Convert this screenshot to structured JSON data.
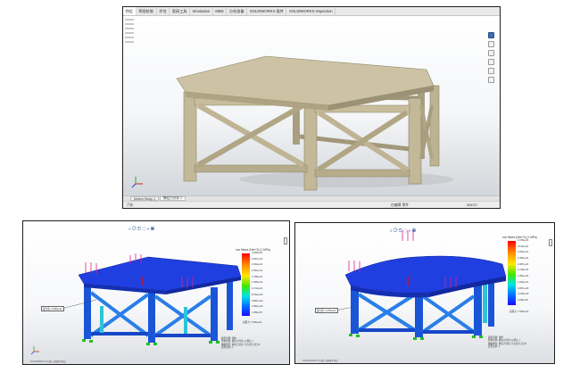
{
  "top_window": {
    "tabs": [
      "特征",
      "草图绘制",
      "评估",
      "直接工具",
      "Simulation",
      "MBD",
      "分析准备",
      "SOLIDWORKS 插件",
      "SOLIDWORKS Inspection"
    ],
    "active_tab_index": 0,
    "study_tabs": [
      "Motion Study 1",
      "静应力分析 1"
    ],
    "active_study_index": 1,
    "status": {
      "left": "汽车",
      "middle": "在编辑 零件",
      "right": "MMGS"
    }
  },
  "bottom_left": {
    "plot_title": "von Mises (N/m^2) (1 MPa)",
    "legend_ticks": [
      "2.930e+01",
      "2.637e+01",
      "2.344e+01",
      "2.051e+01",
      "1.758e+01",
      "1.465e+01",
      "1.172e+01",
      "8.792e+00",
      "5.861e+00",
      "2.931e+00",
      "1.456e-05"
    ],
    "probe_label": "最大值: 2.930e+01",
    "yield_label": "屈服力: 7.500e+01",
    "info_lines": [
      "模型名称: 钢台",
      "算例名称: 静应力分析 1(-默认-)",
      "图解类型: 静应力分析 节点应力 应力1",
      "变形比例: 1"
    ],
    "footer": "SOLIDWORKS 学习版: 仅限教学用途"
  },
  "bottom_right": {
    "plot_title": "von Mises (N/m^2) (1 MPa)",
    "legend_ticks": [
      "3.478e+01",
      "3.130e+01",
      "2.782e+01",
      "2.435e+01",
      "2.087e+01",
      "1.739e+01",
      "1.391e+01",
      "1.043e+01",
      "6.957e+00",
      "3.478e+00",
      "3.026e-05"
    ],
    "probe_label": "最大值: 3.478e+01",
    "yield_label": "屈服力: 7.500e+01",
    "info_lines": [
      "模型名称: 钢台",
      "算例名称: 静应力分析 2(-默认-)",
      "图解类型: 静应力分析 节点应力 应力1",
      "变形比例: 1"
    ],
    "footer": "SOLIDWORKS 学习版: 仅限教学用途"
  },
  "colors": {
    "model_tan": "#c8bd9c",
    "fea_blue": "#1f3fe0"
  },
  "icons": [
    "zoom-icon",
    "rotate-icon",
    "view-orientation-icon",
    "display-style-icon",
    "coordinate-triad-icon"
  ]
}
